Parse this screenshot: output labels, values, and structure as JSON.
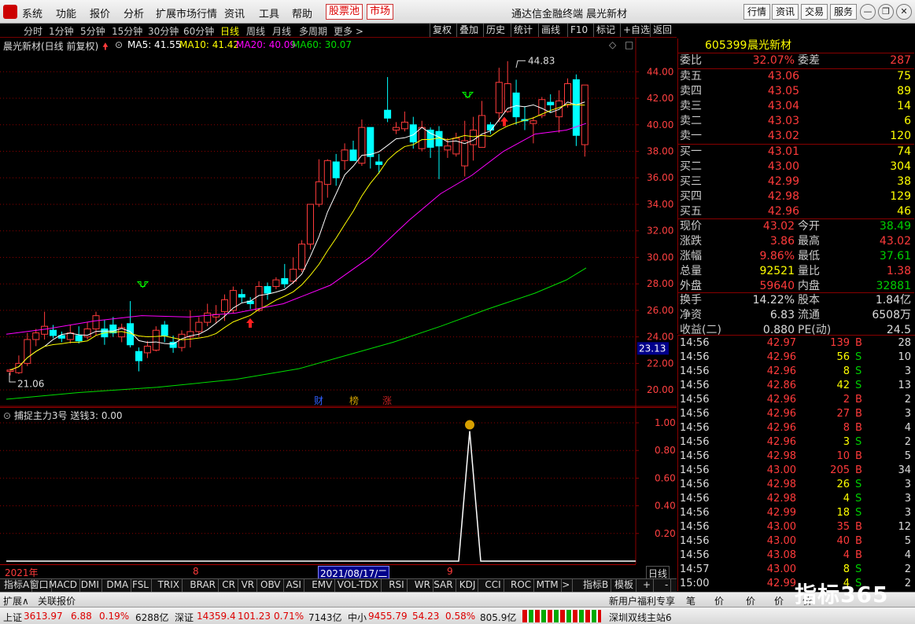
{
  "menu": {
    "items": [
      "系统",
      "功能",
      "报价",
      "分析",
      "扩展市场行情",
      "资讯",
      "工具",
      "帮助"
    ],
    "hot_items": [
      "股票池",
      "市场"
    ],
    "title": "通达信金融终端  晨光新材",
    "right_buttons": [
      "行情",
      "资讯",
      "交易",
      "服务"
    ]
  },
  "toolbar": {
    "periods": [
      "分时",
      "1分钟",
      "5分钟",
      "15分钟",
      "30分钟",
      "60分钟",
      "日线",
      "周线",
      "月线",
      "多周期",
      "更多 >"
    ],
    "active_period": "日线",
    "tools": [
      "复权",
      "叠加",
      "历史",
      "统计",
      "画线",
      "F10",
      "标记",
      "+自选",
      "返回"
    ]
  },
  "chart_header": {
    "name": "晨光新材(日线 前复权)",
    "ma5": "MA5: 41.55",
    "ma10": "MA10: 41.42",
    "ma20": "MA20: 40.09",
    "ma60": "MA60: 30.07"
  },
  "colors": {
    "up": "#ff3b3b",
    "down": "#00ffff",
    "ma5": "#ffffff",
    "ma10": "#ffff00",
    "ma20": "#ff00ff",
    "ma60": "#00dd00",
    "grid": "#8b0000"
  },
  "chart_data": {
    "type": "candlestick",
    "y_axis_ticks": [
      "44.00",
      "42.00",
      "40.00",
      "38.00",
      "36.00",
      "34.00",
      "32.00",
      "30.00",
      "28.00",
      "26.00",
      "24.00",
      "22.00",
      "20.00"
    ],
    "ylim": [
      19,
      45.5
    ],
    "current_price_label": "23.13",
    "high_marker": "44.83",
    "low_marker": "21.06",
    "events": [
      "财",
      "榜",
      "涨"
    ],
    "candles": [
      {
        "o": 21.4,
        "c": 21.5,
        "h": 21.6,
        "l": 21.1
      },
      {
        "o": 21.3,
        "c": 22.0,
        "h": 22.6,
        "l": 21.2
      },
      {
        "o": 22.0,
        "c": 23.8,
        "h": 24.3,
        "l": 21.8
      },
      {
        "o": 23.8,
        "c": 24.3,
        "h": 24.6,
        "l": 23.3
      },
      {
        "o": 24.2,
        "c": 24.8,
        "h": 25.9,
        "l": 23.8
      },
      {
        "o": 24.5,
        "c": 24.1,
        "h": 24.9,
        "l": 23.9
      },
      {
        "o": 24.1,
        "c": 23.9,
        "h": 24.4,
        "l": 23.6
      },
      {
        "o": 23.8,
        "c": 24.3,
        "h": 24.9,
        "l": 23.5
      },
      {
        "o": 24.1,
        "c": 23.7,
        "h": 24.8,
        "l": 23.5
      },
      {
        "o": 24.0,
        "c": 24.6,
        "h": 25.1,
        "l": 23.8
      },
      {
        "o": 24.6,
        "c": 25.6,
        "h": 25.9,
        "l": 24.1
      },
      {
        "o": 24.6,
        "c": 24.0,
        "h": 25.3,
        "l": 23.4
      },
      {
        "o": 24.9,
        "c": 24.3,
        "h": 25.5,
        "l": 24.0
      },
      {
        "o": 24.0,
        "c": 24.7,
        "h": 25.0,
        "l": 23.6
      },
      {
        "o": 25.0,
        "c": 23.4,
        "h": 26.7,
        "l": 23.2
      },
      {
        "o": 22.9,
        "c": 22.2,
        "h": 23.2,
        "l": 21.4
      },
      {
        "o": 22.8,
        "c": 23.3,
        "h": 23.7,
        "l": 22.4
      },
      {
        "o": 23.0,
        "c": 24.5,
        "h": 24.8,
        "l": 22.9
      },
      {
        "o": 24.9,
        "c": 24.1,
        "h": 25.2,
        "l": 23.6
      },
      {
        "o": 23.6,
        "c": 23.2,
        "h": 24.1,
        "l": 22.8
      },
      {
        "o": 23.2,
        "c": 24.2,
        "h": 24.5,
        "l": 22.9
      },
      {
        "o": 24.0,
        "c": 24.4,
        "h": 26.0,
        "l": 23.2
      },
      {
        "o": 24.4,
        "c": 25.1,
        "h": 25.5,
        "l": 24.0
      },
      {
        "o": 25.1,
        "c": 25.8,
        "h": 26.5,
        "l": 24.8
      },
      {
        "o": 25.5,
        "c": 25.7,
        "h": 26.4,
        "l": 25.0
      },
      {
        "o": 25.9,
        "c": 26.8,
        "h": 27.2,
        "l": 25.2
      },
      {
        "o": 26.0,
        "c": 27.5,
        "h": 27.8,
        "l": 25.8
      },
      {
        "o": 27.2,
        "c": 27.0,
        "h": 27.6,
        "l": 26.6
      },
      {
        "o": 26.7,
        "c": 26.5,
        "h": 27.0,
        "l": 26.1
      },
      {
        "o": 26.0,
        "c": 27.8,
        "h": 28.2,
        "l": 25.9
      },
      {
        "o": 27.8,
        "c": 27.3,
        "h": 28.1,
        "l": 26.8
      },
      {
        "o": 27.8,
        "c": 28.3,
        "h": 28.5,
        "l": 27.6
      },
      {
        "o": 28.4,
        "c": 28.0,
        "h": 29.5,
        "l": 27.7
      },
      {
        "o": 28.2,
        "c": 29.1,
        "h": 30.0,
        "l": 28.0
      },
      {
        "o": 29.1,
        "c": 31.0,
        "h": 31.3,
        "l": 28.9
      },
      {
        "o": 31.0,
        "c": 34.0,
        "h": 34.0,
        "l": 30.6
      },
      {
        "o": 34.0,
        "c": 35.7,
        "h": 37.4,
        "l": 33.8
      },
      {
        "o": 35.5,
        "c": 37.3,
        "h": 37.4,
        "l": 34.5
      },
      {
        "o": 37.2,
        "c": 36.0,
        "h": 37.8,
        "l": 35.4
      },
      {
        "o": 37.3,
        "c": 38.1,
        "h": 38.6,
        "l": 36.6
      },
      {
        "o": 38.1,
        "c": 37.3,
        "h": 38.8,
        "l": 37.3
      },
      {
        "o": 37.1,
        "c": 39.8,
        "h": 40.4,
        "l": 36.9
      },
      {
        "o": 39.8,
        "c": 37.6,
        "h": 39.7,
        "l": 36.7
      },
      {
        "o": 37.2,
        "c": 37.0,
        "h": 37.8,
        "l": 36.3
      },
      {
        "o": 41.1,
        "c": 40.5,
        "h": 43.6,
        "l": 40.2
      },
      {
        "o": 39.6,
        "c": 39.8,
        "h": 40.2,
        "l": 39.3
      },
      {
        "o": 39.7,
        "c": 40.2,
        "h": 41.0,
        "l": 39.5
      },
      {
        "o": 40.0,
        "c": 38.7,
        "h": 40.6,
        "l": 38.2
      },
      {
        "o": 38.2,
        "c": 39.8,
        "h": 40.3,
        "l": 38.0
      },
      {
        "o": 39.6,
        "c": 38.3,
        "h": 39.8,
        "l": 37.5
      },
      {
        "o": 39.5,
        "c": 38.4,
        "h": 39.9,
        "l": 35.9
      },
      {
        "o": 38.1,
        "c": 38.4,
        "h": 39.0,
        "l": 37.5
      },
      {
        "o": 37.8,
        "c": 39.0,
        "h": 39.4,
        "l": 37.6
      },
      {
        "o": 36.9,
        "c": 38.8,
        "h": 40.3,
        "l": 36.1
      },
      {
        "o": 38.5,
        "c": 39.6,
        "h": 40.6,
        "l": 37.3
      },
      {
        "o": 38.3,
        "c": 40.7,
        "h": 41.8,
        "l": 38.3
      },
      {
        "o": 40.0,
        "c": 39.6,
        "h": 40.2,
        "l": 39.3
      },
      {
        "o": 40.9,
        "c": 43.2,
        "h": 44.3,
        "l": 40.2
      },
      {
        "o": 41.0,
        "c": 43.1,
        "h": 44.8,
        "l": 40.9
      },
      {
        "o": 42.4,
        "c": 40.6,
        "h": 43.4,
        "l": 40.0
      },
      {
        "o": 40.4,
        "c": 40.3,
        "h": 41.4,
        "l": 39.6
      },
      {
        "o": 40.1,
        "c": 40.3,
        "h": 40.6,
        "l": 38.6
      },
      {
        "o": 40.7,
        "c": 41.9,
        "h": 42.1,
        "l": 40.5
      },
      {
        "o": 41.7,
        "c": 41.5,
        "h": 42.3,
        "l": 40.9
      },
      {
        "o": 40.6,
        "c": 41.8,
        "h": 42.6,
        "l": 39.4
      },
      {
        "o": 41.5,
        "c": 43.1,
        "h": 43.5,
        "l": 41.3
      },
      {
        "o": 43.4,
        "c": 39.2,
        "h": 43.8,
        "l": 38.4
      },
      {
        "o": 38.5,
        "c": 43.0,
        "h": 43.0,
        "l": 37.6
      }
    ],
    "ma20_points": [
      [
        8,
        24.2
      ],
      [
        60,
        24.6
      ],
      [
        120,
        25.2
      ],
      [
        180,
        25.6
      ],
      [
        240,
        25.5
      ],
      [
        300,
        25.8
      ],
      [
        360,
        26.5
      ],
      [
        420,
        27.9
      ],
      [
        470,
        30.0
      ],
      [
        520,
        32.8
      ],
      [
        560,
        34.8
      ],
      [
        600,
        36.2
      ],
      [
        640,
        38.0
      ],
      [
        680,
        39.3
      ],
      [
        720,
        39.6
      ],
      [
        745,
        40.1
      ]
    ],
    "ma60_points": [
      [
        8,
        19.3
      ],
      [
        100,
        19.8
      ],
      [
        200,
        20.2
      ],
      [
        300,
        20.8
      ],
      [
        380,
        21.6
      ],
      [
        440,
        22.6
      ],
      [
        500,
        23.6
      ],
      [
        560,
        24.8
      ],
      [
        620,
        26.1
      ],
      [
        680,
        27.3
      ],
      [
        720,
        28.3
      ],
      [
        745,
        29.2
      ]
    ],
    "indicator_title": "捕捉主力3号  送钱3: 0.00",
    "indicator_ticks": [
      "1.00",
      "0.80",
      "0.60",
      "0.40",
      "0.20"
    ],
    "indicator_spike_x": 597
  },
  "time_axis": {
    "left": "2021年",
    "mid": "8",
    "sel": "2021/08/17/二",
    "right": "9",
    "period": "日线"
  },
  "quote": {
    "code": "605399",
    "name": "晨光新材",
    "weibi_label": "委比",
    "weibi": "32.07%",
    "weicha_label": "委差",
    "weicha": "287",
    "asks": [
      [
        "卖五",
        "43.06",
        "75"
      ],
      [
        "卖四",
        "43.05",
        "89"
      ],
      [
        "卖三",
        "43.04",
        "14"
      ],
      [
        "卖二",
        "43.03",
        "6"
      ],
      [
        "卖一",
        "43.02",
        "120"
      ]
    ],
    "bids": [
      [
        "买一",
        "43.01",
        "74"
      ],
      [
        "买二",
        "43.00",
        "304"
      ],
      [
        "买三",
        "42.99",
        "38"
      ],
      [
        "买四",
        "42.98",
        "129"
      ],
      [
        "买五",
        "42.96",
        "46"
      ]
    ],
    "stats": [
      [
        "现价",
        "43.02",
        "今开",
        "38.49"
      ],
      [
        "涨跌",
        "3.86",
        "最高",
        "43.02"
      ],
      [
        "涨幅",
        "9.86%",
        "最低",
        "37.61"
      ],
      [
        "总量",
        "92521",
        "量比",
        "1.38"
      ],
      [
        "外盘",
        "59640",
        "内盘",
        "32881"
      ]
    ],
    "stats2": [
      [
        "换手",
        "14.22%",
        "股本",
        "1.84亿"
      ],
      [
        "净资",
        "6.83",
        "流通",
        "6508万"
      ],
      [
        "收益(二)",
        "0.880",
        "PE(动)",
        "24.5"
      ]
    ]
  },
  "ticks": [
    [
      "14:56",
      "42.97",
      "139",
      "B",
      "28"
    ],
    [
      "14:56",
      "42.96",
      "56",
      "S",
      "10"
    ],
    [
      "14:56",
      "42.96",
      "8",
      "S",
      "3"
    ],
    [
      "14:56",
      "42.86",
      "42",
      "S",
      "13"
    ],
    [
      "14:56",
      "42.96",
      "2",
      "B",
      "2"
    ],
    [
      "14:56",
      "42.96",
      "27",
      "B",
      "3"
    ],
    [
      "14:56",
      "42.96",
      "8",
      "B",
      "4"
    ],
    [
      "14:56",
      "42.96",
      "3",
      "S",
      "2"
    ],
    [
      "14:56",
      "42.98",
      "10",
      "B",
      "5"
    ],
    [
      "14:56",
      "43.00",
      "205",
      "B",
      "34"
    ],
    [
      "14:56",
      "42.98",
      "26",
      "S",
      "3"
    ],
    [
      "14:56",
      "42.98",
      "4",
      "S",
      "3"
    ],
    [
      "14:56",
      "42.99",
      "18",
      "S",
      "3"
    ],
    [
      "14:56",
      "43.00",
      "35",
      "B",
      "12"
    ],
    [
      "14:56",
      "43.00",
      "40",
      "B",
      "5"
    ],
    [
      "14:56",
      "43.08",
      "4",
      "B",
      "4"
    ],
    [
      "14:57",
      "43.00",
      "8",
      "S",
      "2"
    ],
    [
      "15:00",
      "42.99",
      "4",
      "S",
      "2"
    ]
  ],
  "bottom_tabs": [
    "指标A",
    "窗口",
    "MACD",
    "DMI",
    "DMA",
    "FSL",
    "TRIX",
    "BRAR",
    "CR",
    "VR",
    "OBV",
    "ASI",
    "EMV",
    "VOL-TDX",
    "RSI",
    "WR",
    "SAR",
    "KDJ",
    "CCI",
    "ROC",
    "MTM",
    ">"
  ],
  "bottom_right": [
    "指标B",
    "模板",
    "+",
    "-"
  ],
  "ext_bar": {
    "left1": "扩展∧",
    "left2": "关联报价",
    "right": "新用户福利专享",
    "tabs": [
      "笔",
      "价",
      "价",
      "价",
      "价"
    ]
  },
  "status": {
    "sh_label": "上证",
    "sh_val": "3613.97",
    "sh_chg": "6.88",
    "sh_pct": "0.19%",
    "sh_amt": "6288亿",
    "sz_label": "深证",
    "sz_val": "14359.4",
    "sz_chg": "101.23",
    "sz_pct": "0.71%",
    "sz_amt": "7143亿",
    "zx_label": "中小",
    "zx_val": "9455.79",
    "zx_chg": "54.23",
    "zx_pct": "0.58%",
    "zx_amt": "805.9亿",
    "server": "深圳双线主站6"
  },
  "watermark": "指标365"
}
